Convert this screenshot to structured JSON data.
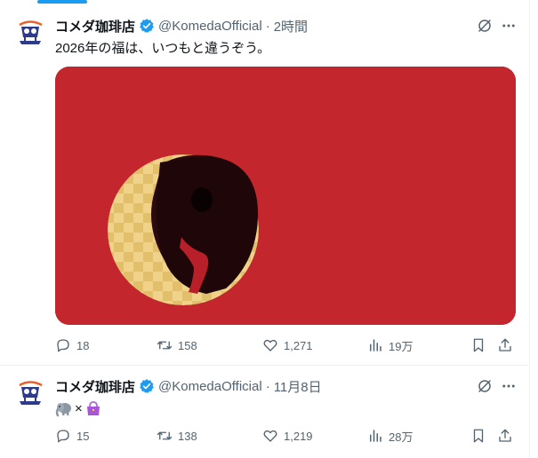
{
  "tweets": [
    {
      "author_name": "コメダ珈琲店",
      "handle": "@KomedaOfficial",
      "separator": "·",
      "time": "2時間",
      "text": "2026年の福は、いつもと違うぞう。",
      "has_media": true,
      "stats": {
        "replies": "18",
        "retweets": "158",
        "likes": "1,271",
        "views": "19万"
      }
    },
    {
      "author_name": "コメダ珈琲店",
      "handle": "@KomedaOfficial",
      "separator": "·",
      "time": "11月8日",
      "text_parts": {
        "times": "×"
      },
      "stats": {
        "replies": "15",
        "retweets": "138",
        "likes": "1,219",
        "views": "28万"
      }
    }
  ],
  "colors": {
    "accent": "#1d9bf0",
    "media_background": "#c4262e",
    "muted_text": "#536471"
  },
  "icons": [
    "grok-icon",
    "more-icon",
    "verified-badge-icon",
    "reply-icon",
    "retweet-icon",
    "like-icon",
    "views-icon",
    "bookmark-icon",
    "share-icon",
    "elephant-emoji-icon",
    "handbag-emoji-icon"
  ]
}
